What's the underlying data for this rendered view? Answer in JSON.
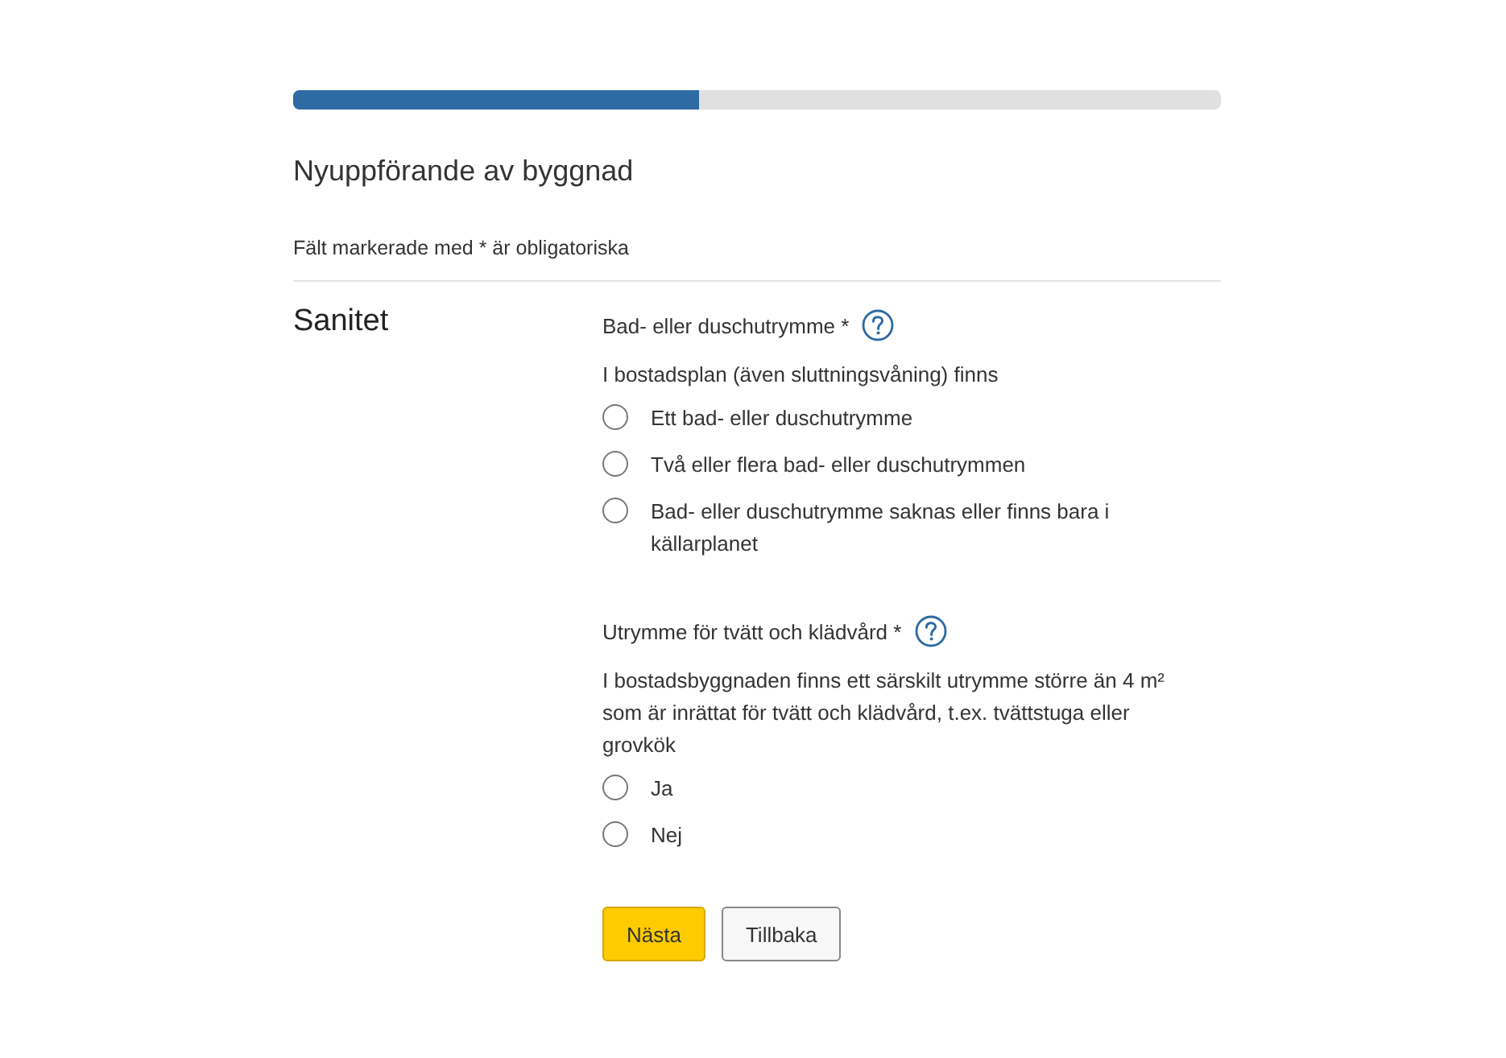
{
  "progress": {
    "level": 0.4375
  },
  "title": "Nyuppförande av byggnad",
  "required_note": "Fält markerade med * är obligatoriska",
  "section": {
    "heading": "Sanitet",
    "questions": [
      {
        "label": "Bad- eller duschutrymme *",
        "help": true,
        "description": "I bostadsplan (även sluttningsvåning) finns",
        "options": [
          {
            "label": "Ett bad- eller duschutrymme",
            "selected": false
          },
          {
            "label": "Två eller flera bad- eller duschutrymmen",
            "selected": false
          },
          {
            "label": "Bad- eller duschutrymme saknas eller finns bara i källarplanet",
            "selected": false
          }
        ]
      },
      {
        "label": "Utrymme för tvätt och klädvård *",
        "help": true,
        "description": "I bostadsbyggnaden finns ett särskilt utrymme större än 4 m² som är inrättat för tvätt och klädvård, t.ex. tvättstuga eller grovkök",
        "options": [
          {
            "label": "Ja",
            "selected": false
          },
          {
            "label": "Nej",
            "selected": false
          }
        ]
      }
    ]
  },
  "buttons": [
    {
      "label": "Nästa",
      "kind": "primary"
    },
    {
      "label": "Tillbaka",
      "kind": "secondary"
    }
  ]
}
